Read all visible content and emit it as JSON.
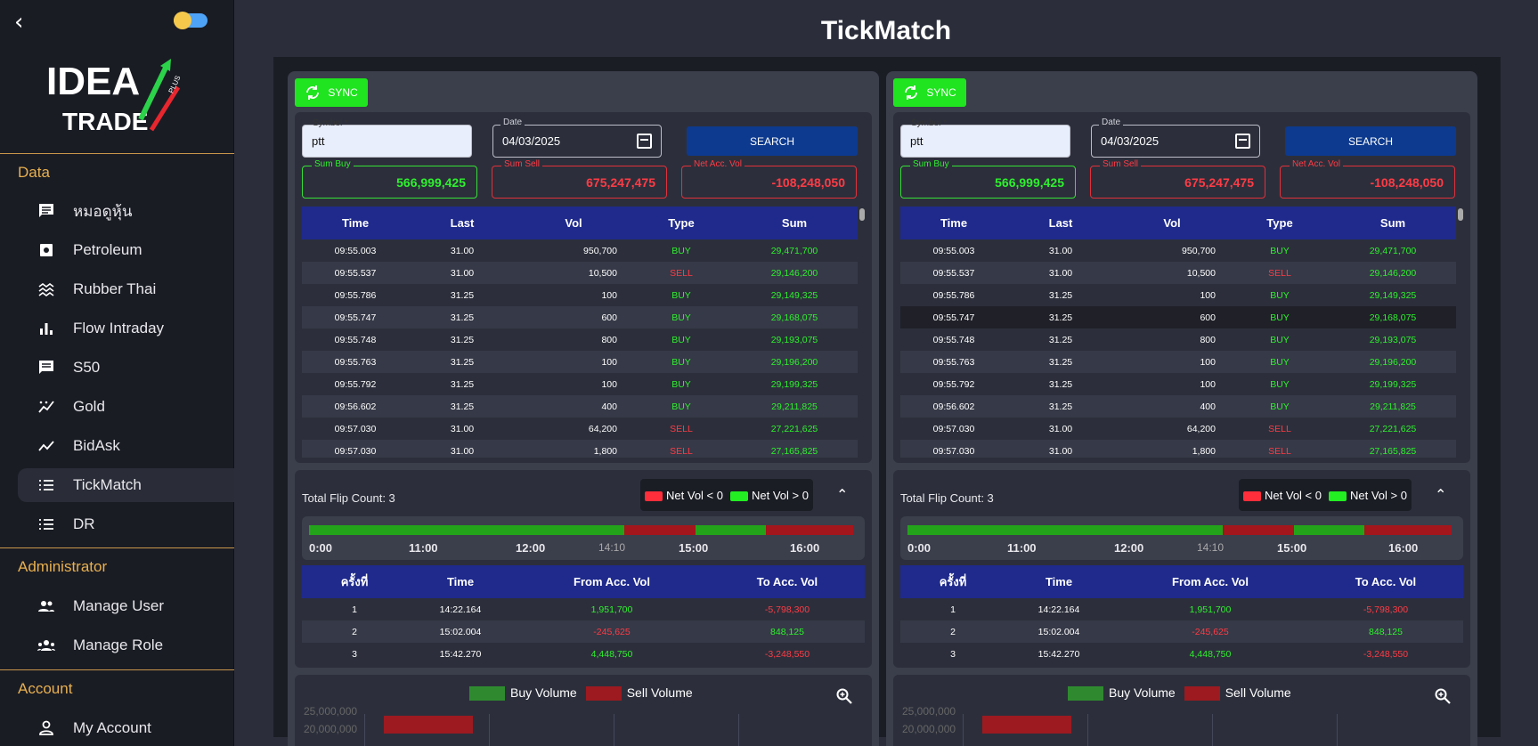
{
  "sidebar": {
    "logo_line1": "IDEA",
    "logo_line2": "TRADE",
    "logo_plus": "PLUS",
    "sections": [
      {
        "title": "Data",
        "items": [
          {
            "label": "หมอดูหุ้น",
            "icon": "chat-icon"
          },
          {
            "label": "Petroleum",
            "icon": "fuel-icon"
          },
          {
            "label": "Rubber Thai",
            "icon": "waves-icon"
          },
          {
            "label": "Flow Intraday",
            "icon": "bar-chart-icon"
          },
          {
            "label": "S50",
            "icon": "message-icon"
          },
          {
            "label": "Gold",
            "icon": "trend-dots-icon"
          },
          {
            "label": "BidAsk",
            "icon": "trend-line-icon"
          },
          {
            "label": "TickMatch",
            "icon": "list-icon",
            "active": true
          },
          {
            "label": "DR",
            "icon": "list-icon"
          }
        ]
      },
      {
        "title": "Administrator",
        "items": [
          {
            "label": "Manage User",
            "icon": "users-icon"
          },
          {
            "label": "Manage Role",
            "icon": "group-icon"
          }
        ]
      },
      {
        "title": "Account",
        "items": [
          {
            "label": "My Account",
            "icon": "person-icon"
          }
        ]
      }
    ]
  },
  "page_title": "TickMatch",
  "panel": {
    "sync_label": "SYNC",
    "symbol_label": "Symbol *",
    "symbol_value": "ptt",
    "date_label": "Date",
    "date_value": "04/03/2025",
    "search_label": "SEARCH",
    "sum_buy_label": "Sum Buy",
    "sum_buy": "566,999,425",
    "sum_sell_label": "Sum Sell",
    "sum_sell": "675,247,475",
    "net_label": "Net Acc. Vol",
    "net_value": "-108,248,050",
    "tick_headers": [
      "Time",
      "Last",
      "Vol",
      "Type",
      "Sum"
    ],
    "ticks": [
      [
        "09:55.003",
        "31.00",
        "950,700",
        "BUY",
        "29,471,700"
      ],
      [
        "09:55.537",
        "31.00",
        "10,500",
        "SELL",
        "29,146,200"
      ],
      [
        "09:55.786",
        "31.25",
        "100",
        "BUY",
        "29,149,325"
      ],
      [
        "09:55.747",
        "31.25",
        "600",
        "BUY",
        "29,168,075"
      ],
      [
        "09:55.748",
        "31.25",
        "800",
        "BUY",
        "29,193,075"
      ],
      [
        "09:55.763",
        "31.25",
        "100",
        "BUY",
        "29,196,200"
      ],
      [
        "09:55.792",
        "31.25",
        "100",
        "BUY",
        "29,199,325"
      ],
      [
        "09:56.602",
        "31.25",
        "400",
        "BUY",
        "29,211,825"
      ],
      [
        "09:57.030",
        "31.00",
        "64,200",
        "SELL",
        "27,221,625"
      ],
      [
        "09:57.030",
        "31.00",
        "1,800",
        "SELL",
        "27,165,825"
      ]
    ],
    "flip_count_text": "Total Flip Count: 3",
    "legend_neg": "Net Vol < 0",
    "legend_pos": "Net Vol > 0",
    "timeline_labels": [
      "0:00",
      "11:00",
      "12:00",
      "14:10",
      "15:00",
      "16:00"
    ],
    "timeline_segments": [
      {
        "color": "#22a31a",
        "weight": 58
      },
      {
        "color": "#a3161c",
        "weight": 13
      },
      {
        "color": "#22a31a",
        "weight": 13
      },
      {
        "color": "#a3161c",
        "weight": 16
      }
    ],
    "flip_headers": [
      "ครั้งที่",
      "Time",
      "From Acc. Vol",
      "To Acc. Vol"
    ],
    "flips": [
      [
        "1",
        "14:22.164",
        "1,951,700",
        "-5,798,300"
      ],
      [
        "2",
        "15:02.004",
        "-245,625",
        "848,125"
      ],
      [
        "3",
        "15:42.270",
        "4,448,750",
        "-3,248,550"
      ]
    ],
    "vol_legend_buy": "Buy Volume",
    "vol_legend_sell": "Sell Volume",
    "vol_y_ticks": [
      "25,000,000",
      "20,000,000"
    ]
  },
  "colors": {
    "buy": "#2ef02e",
    "sell": "#ff3b45",
    "header": "#1f2a8c",
    "accent": "#e8b04f"
  }
}
